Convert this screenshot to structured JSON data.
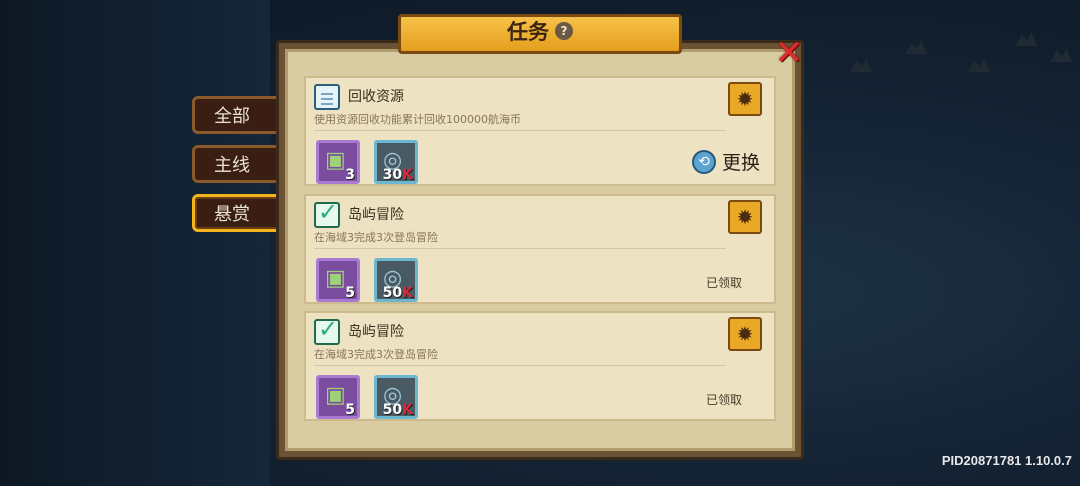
{
  "header": {
    "title": "任务",
    "help_icon": "question-icon"
  },
  "tabs": [
    {
      "label": "全部",
      "active": false
    },
    {
      "label": "主线",
      "active": false
    },
    {
      "label": "悬赏",
      "active": true
    }
  ],
  "quests": [
    {
      "icon": "document-icon",
      "title": "回收资源",
      "desc": "使用资源回收功能累计回收100000航海币",
      "rewards": [
        {
          "icon": "tank-icon",
          "count": "3",
          "suffix": ""
        },
        {
          "icon": "coin-icon",
          "count": "30",
          "suffix": "K"
        }
      ],
      "action": "更换",
      "status": ""
    },
    {
      "icon": "check-icon",
      "title": "岛屿冒险",
      "desc": "在海域3完成3次登岛冒险",
      "rewards": [
        {
          "icon": "tank-icon",
          "count": "5",
          "suffix": ""
        },
        {
          "icon": "coin-icon",
          "count": "50",
          "suffix": "K"
        }
      ],
      "action": "",
      "status": "已领取"
    },
    {
      "icon": "check-icon",
      "title": "岛屿冒险",
      "desc": "在海域3完成3次登岛冒险",
      "rewards": [
        {
          "icon": "tank-icon",
          "count": "5",
          "suffix": ""
        },
        {
          "icon": "coin-icon",
          "count": "50",
          "suffix": "K"
        }
      ],
      "action": "",
      "status": "已领取"
    }
  ],
  "footer": {
    "pid": "PID20871781 1.10.0.7"
  },
  "colors": {
    "accent": "#f2b31c",
    "panel": "#d9cba2",
    "close": "#e22a2a",
    "k_suffix": "#d8283a"
  }
}
